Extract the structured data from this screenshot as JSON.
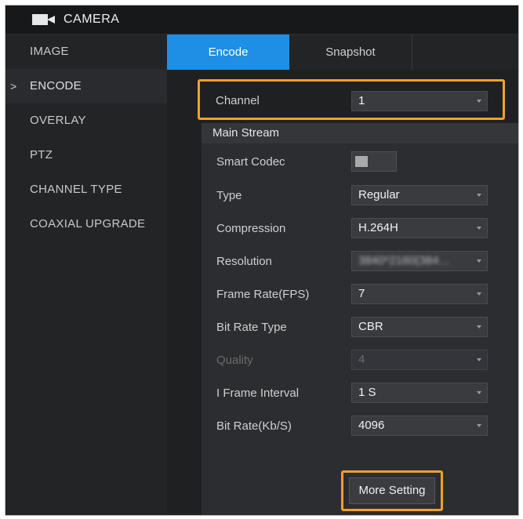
{
  "window": {
    "title": "CAMERA",
    "icon": "camera-icon"
  },
  "sidebar": {
    "items": [
      {
        "label": "IMAGE",
        "active": false
      },
      {
        "label": "ENCODE",
        "active": true,
        "marker": ">"
      },
      {
        "label": "OVERLAY",
        "active": false
      },
      {
        "label": "PTZ",
        "active": false
      },
      {
        "label": "CHANNEL TYPE",
        "active": false
      },
      {
        "label": "COAXIAL UPGRADE",
        "active": false
      }
    ]
  },
  "tabs": [
    {
      "label": "Encode",
      "active": true
    },
    {
      "label": "Snapshot",
      "active": false
    }
  ],
  "channel": {
    "label": "Channel",
    "value": "1"
  },
  "main_stream": {
    "header": "Main Stream",
    "smart_codec": {
      "label": "Smart Codec",
      "enabled": false
    },
    "fields": [
      {
        "label": "Type",
        "value": "Regular"
      },
      {
        "label": "Compression",
        "value": "H.264H"
      },
      {
        "label": "Resolution",
        "value": "3840*2160(384…"
      },
      {
        "label": "Frame Rate(FPS)",
        "value": "7"
      },
      {
        "label": "Bit Rate Type",
        "value": "CBR"
      },
      {
        "label": "Quality",
        "value": "4"
      },
      {
        "label": "I Frame Interval",
        "value": "1 S"
      },
      {
        "label": "Bit Rate(Kb/S)",
        "value": "4096"
      }
    ]
  },
  "more_setting_button": "More Setting",
  "colors": {
    "accent": "#1e8fe4",
    "highlight": "#f1a12a",
    "background": "#1f2022"
  }
}
